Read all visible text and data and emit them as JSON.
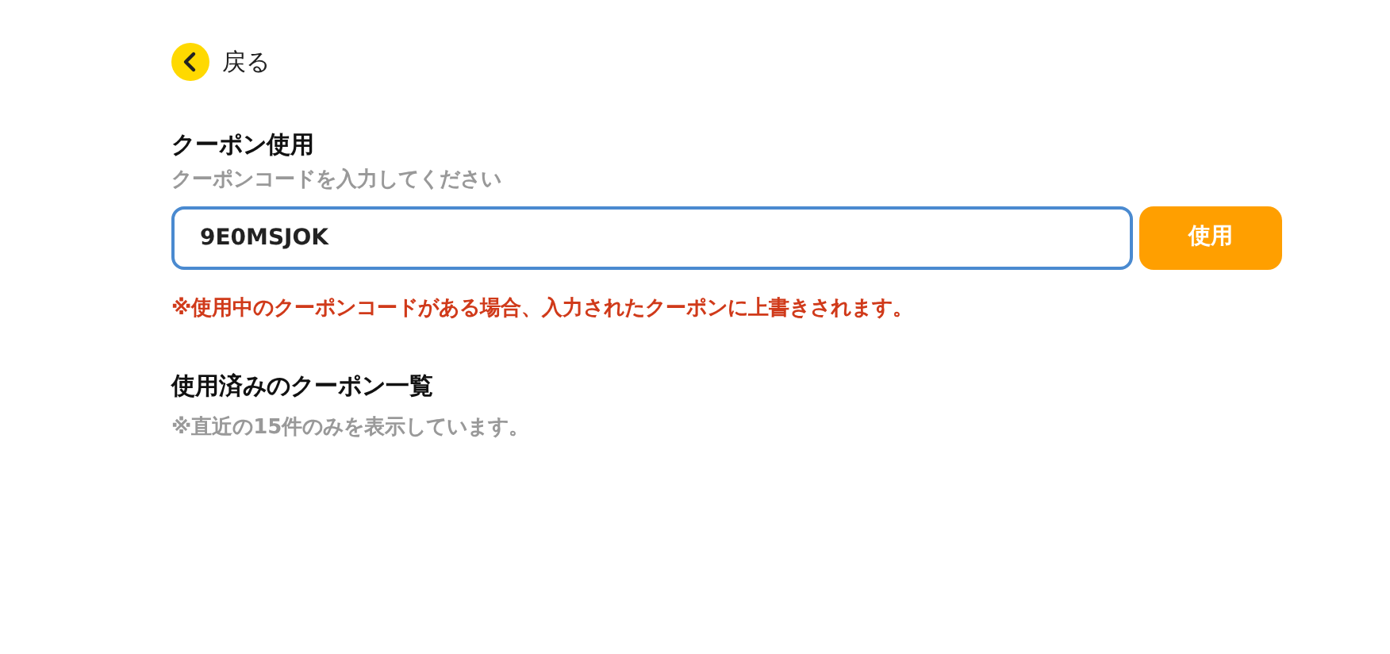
{
  "back_link": {
    "label": "戻る"
  },
  "coupon_use": {
    "heading": "クーポン使用",
    "field_label": "クーポンコードを入力してください",
    "value": "9E0MSJOK",
    "focused": true,
    "button": "使用",
    "warning": "※使用中のクーポンコードがある場合、入力されたクーポンに上書きされます。"
  },
  "used_coupons": {
    "heading": "使用済みのクーポン一覧",
    "note": "※直近の15件のみを表示しています。"
  }
}
